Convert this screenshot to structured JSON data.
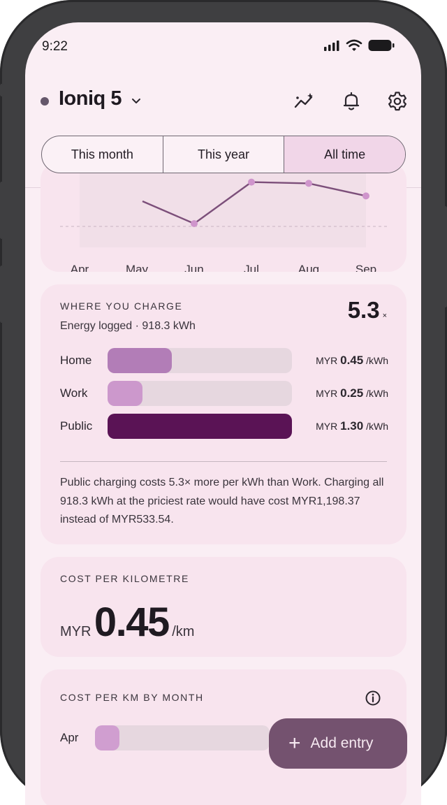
{
  "status_bar": {
    "time": "9:22"
  },
  "header": {
    "vehicle_name": "Ioniq 5"
  },
  "period_tabs": [
    "This month",
    "This year",
    "All time"
  ],
  "selected_tab": "All time",
  "chart_data": {
    "type": "line",
    "categories": [
      "Apr",
      "May",
      "Jun",
      "Jul",
      "Aug",
      "Sep"
    ],
    "series": [
      {
        "values": [
          null,
          null,
          0.2,
          0.53,
          0.52,
          0.42
        ]
      }
    ],
    "note": "partially scrolled out of view; values relative"
  },
  "where_you_charge": {
    "title": "WHERE YOU CHARGE",
    "subtitle": "Energy logged · 918.3 kWh",
    "ratio_value": "5.3",
    "ratio_suffix": "×",
    "rows": [
      {
        "label": "Home",
        "currency": "MYR",
        "rate": "0.45",
        "unit": "/kWh",
        "share": 0.35,
        "color": "#b27db7"
      },
      {
        "label": "Work",
        "currency": "MYR",
        "rate": "0.25",
        "unit": "/kWh",
        "share": 0.19,
        "color": "#cc98cc"
      },
      {
        "label": "Public",
        "currency": "MYR",
        "rate": "1.30",
        "unit": "/kWh",
        "share": 1.0,
        "color": "#5a1355"
      }
    ],
    "note": "Public charging costs 5.3× more per kWh than Work. Charging all 918.3 kWh at the priciest rate would have cost MYR1,198.37 instead of MYR533.54."
  },
  "cost_per_km": {
    "title": "COST PER KILOMETRE",
    "currency": "MYR",
    "value": "0.45",
    "unit": "/km"
  },
  "cost_by_month": {
    "title": "COST PER KM BY MONTH",
    "rows": [
      {
        "label": "Apr",
        "share": 0.14
      }
    ]
  },
  "fab": {
    "label": "Add entry"
  },
  "colors": {
    "accent": "#74526f",
    "background": "#faeef4",
    "card": "#f8e4ee"
  }
}
